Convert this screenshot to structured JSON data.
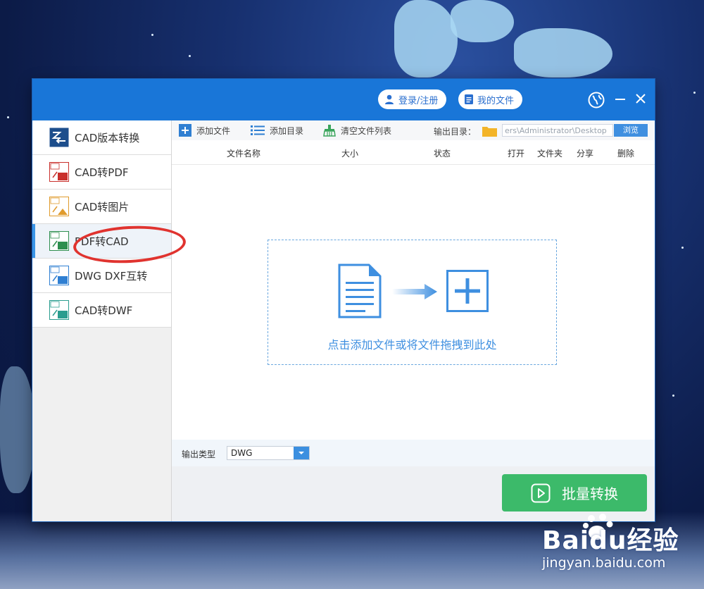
{
  "titlebar": {
    "login_label": "登录/注册",
    "myfiles_label": "我的文件",
    "globe_icon": "globe-icon",
    "minimize_label": "—",
    "close_label": "✕"
  },
  "sidebar": {
    "items": [
      {
        "label": "CAD版本转换",
        "icon": "cad-version-icon"
      },
      {
        "label": "CAD转PDF",
        "icon": "cad-to-pdf-icon"
      },
      {
        "label": "CAD转图片",
        "icon": "cad-to-image-icon"
      },
      {
        "label": "PDF转CAD",
        "icon": "pdf-to-cad-icon",
        "active": true
      },
      {
        "label": "DWG DXF互转",
        "icon": "dwg-dxf-icon"
      },
      {
        "label": "CAD转DWF",
        "icon": "cad-to-dwf-icon"
      }
    ]
  },
  "toolbar": {
    "add_file": "添加文件",
    "add_dir": "添加目录",
    "clear_list": "清空文件列表",
    "output_dir_label": "输出目录：",
    "output_path": "ers\\Administrator\\Desktop",
    "browse": "浏览"
  },
  "table": {
    "headers": {
      "filename": "文件名称",
      "size": "大小",
      "status": "状态",
      "open": "打开",
      "folder": "文件夹",
      "share": "分享",
      "delete": "删除"
    }
  },
  "dropzone": {
    "text": "点击添加文件或将文件拖拽到此处"
  },
  "output": {
    "type_label": "输出类型",
    "type_value": "DWG"
  },
  "footer": {
    "convert_label": "批量转换"
  },
  "watermark": {
    "logo": "Baidu经验",
    "url": "jingyan.baidu.com"
  },
  "colors": {
    "titlebar": "#1976d8",
    "accent": "#3b8fe0",
    "convert": "#3cba6a",
    "annotation_ring": "#e0332f"
  }
}
